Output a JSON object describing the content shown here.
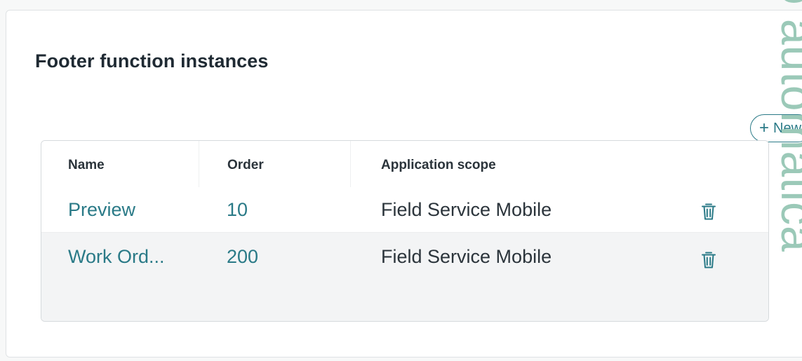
{
  "section": {
    "title": "Footer function instances",
    "new_button_label": "New"
  },
  "table": {
    "columns": [
      "Name",
      "Order",
      "Application scope"
    ],
    "rows": [
      {
        "name": "Preview",
        "order": "10",
        "scope": "Field Service Mobile"
      },
      {
        "name": "Work Ord...",
        "order": "200",
        "scope": "Field Service Mobile"
      }
    ]
  },
  "watermark": {
    "text": "o automatica"
  },
  "colors": {
    "accent": "#2a7a87",
    "watermark": "#9bc9b8",
    "row_alt": "#f3f4f5"
  },
  "icons": {
    "new": "plus-icon",
    "delete": "trash-icon"
  }
}
